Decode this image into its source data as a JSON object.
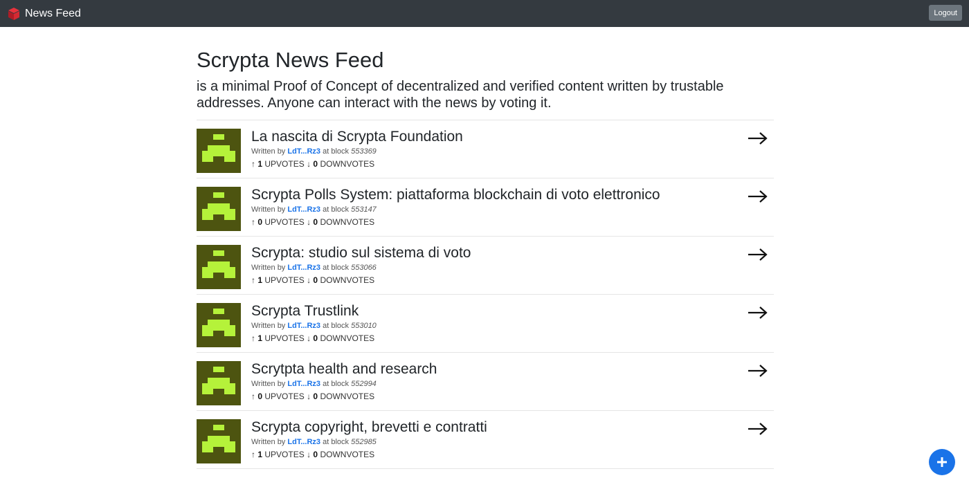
{
  "nav": {
    "brand": "News Feed",
    "logout_label": "Logout"
  },
  "header": {
    "title": "Scrypta News Feed",
    "lead": "is a minimal Proof of Concept of decentralized and verified content written by trustable addresses. Anyone can interact with the news by voting it."
  },
  "labels": {
    "written_by": "Written by",
    "at_block": "at block",
    "upvotes": "UPVOTES",
    "downvotes": "DOWNVOTES",
    "up_arrow": "↑",
    "down_arrow": "↓"
  },
  "icons": {
    "brand": "cube-logo-icon",
    "avatar": "identicon-avatar",
    "open": "arrow-right-icon",
    "add": "plus-icon"
  },
  "colors": {
    "navbar": "#343a40",
    "link": "#1a73e8",
    "avatar_bg": "#4d5410",
    "avatar_fg": "#b5f23a",
    "fab": "#1a73e8"
  },
  "news": [
    {
      "title": "La nascita di Scrypta Foundation",
      "author": "LdT...Rz3",
      "block": "553369",
      "upvotes": "1",
      "downvotes": "0"
    },
    {
      "title": "Scrypta Polls System: piattaforma blockchain di voto elettronico",
      "author": "LdT...Rz3",
      "block": "553147",
      "upvotes": "0",
      "downvotes": "0"
    },
    {
      "title": "Scrypta: studio sul sistema di voto",
      "author": "LdT...Rz3",
      "block": "553066",
      "upvotes": "1",
      "downvotes": "0"
    },
    {
      "title": "Scrypta Trustlink",
      "author": "LdT...Rz3",
      "block": "553010",
      "upvotes": "1",
      "downvotes": "0"
    },
    {
      "title": "Scrytpta health and research",
      "author": "LdT...Rz3",
      "block": "552994",
      "upvotes": "0",
      "downvotes": "0"
    },
    {
      "title": "Scrypta copyright, brevetti e contratti",
      "author": "LdT...Rz3",
      "block": "552985",
      "upvotes": "1",
      "downvotes": "0"
    }
  ]
}
